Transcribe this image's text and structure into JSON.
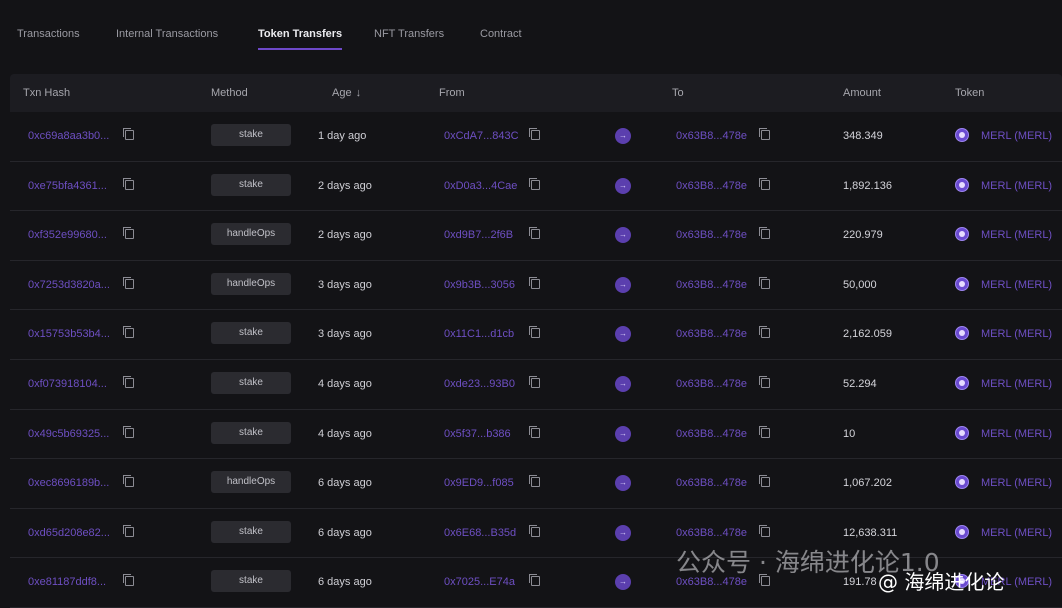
{
  "tabs": [
    {
      "label": "Transactions",
      "active": false
    },
    {
      "label": "Internal Transactions",
      "active": false
    },
    {
      "label": "Token Transfers",
      "active": true
    },
    {
      "label": "NFT Transfers",
      "active": false
    },
    {
      "label": "Contract",
      "active": false
    }
  ],
  "columns": {
    "txn_hash": "Txn Hash",
    "method": "Method",
    "age": "Age",
    "age_sort_icon": "↓",
    "from": "From",
    "to": "To",
    "amount": "Amount",
    "token": "Token"
  },
  "rows": [
    {
      "hash": "0xc69a8aa3b0...",
      "method": "stake",
      "age": "1 day ago",
      "from": "0xCdA7...843C",
      "to": "0x63B8...478e",
      "amount": "348.349",
      "token": "MERL (MERL)"
    },
    {
      "hash": "0xe75bfa4361...",
      "method": "stake",
      "age": "2 days ago",
      "from": "0xD0a3...4Cae",
      "to": "0x63B8...478e",
      "amount": "1,892.136",
      "token": "MERL (MERL)"
    },
    {
      "hash": "0xf352e99680...",
      "method": "handleOps",
      "age": "2 days ago",
      "from": "0xd9B7...2f6B",
      "to": "0x63B8...478e",
      "amount": "220.979",
      "token": "MERL (MERL)"
    },
    {
      "hash": "0x7253d3820a...",
      "method": "handleOps",
      "age": "3 days ago",
      "from": "0x9b3B...3056",
      "to": "0x63B8...478e",
      "amount": "50,000",
      "token": "MERL (MERL)"
    },
    {
      "hash": "0x15753b53b4...",
      "method": "stake",
      "age": "3 days ago",
      "from": "0x11C1...d1cb",
      "to": "0x63B8...478e",
      "amount": "2,162.059",
      "token": "MERL (MERL)"
    },
    {
      "hash": "0xf073918104...",
      "method": "stake",
      "age": "4 days ago",
      "from": "0xde23...93B0",
      "to": "0x63B8...478e",
      "amount": "52.294",
      "token": "MERL (MERL)"
    },
    {
      "hash": "0x49c5b69325...",
      "method": "stake",
      "age": "4 days ago",
      "from": "0x5f37...b386",
      "to": "0x63B8...478e",
      "amount": "10",
      "token": "MERL (MERL)"
    },
    {
      "hash": "0xec8696189b...",
      "method": "handleOps",
      "age": "6 days ago",
      "from": "0x9ED9...f085",
      "to": "0x63B8...478e",
      "amount": "1,067.202",
      "token": "MERL (MERL)"
    },
    {
      "hash": "0xd65d208e82...",
      "method": "stake",
      "age": "6 days ago",
      "from": "0x6E68...B35d",
      "to": "0x63B8...478e",
      "amount": "12,638.311",
      "token": "MERL (MERL)"
    },
    {
      "hash": "0xe81187ddf8...",
      "method": "stake",
      "age": "6 days ago",
      "from": "0x7025...E74a",
      "to": "0x63B8...478e",
      "amount": "191.78",
      "token": "MERL (MERL)"
    }
  ],
  "transfer_arrow_icon": "→",
  "watermark": {
    "line1": "公众号 · 海绵进化论1.0",
    "line2": "@ 海绵进化论"
  },
  "colors": {
    "accent": "#6e4fc3",
    "background": "#131316",
    "header_bg": "#1c1c21"
  },
  "icons": {
    "copy": "copy-icon",
    "arrow": "arrow-right-icon",
    "token": "merl-token-icon",
    "sort": "arrow-down-icon"
  }
}
